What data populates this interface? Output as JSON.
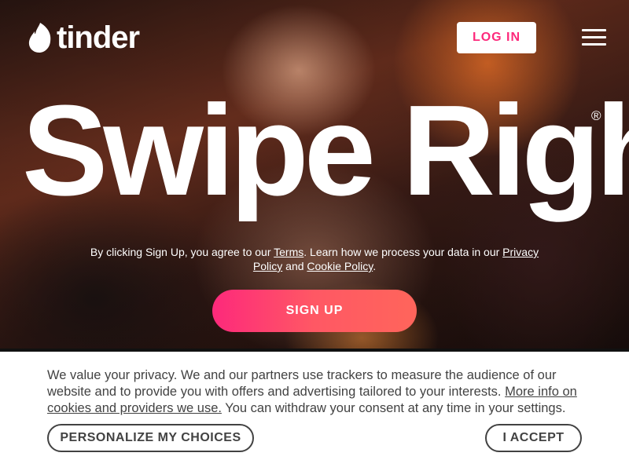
{
  "header": {
    "brand": "tinder",
    "login_label": "LOG IN"
  },
  "hero": {
    "headline": "Swipe Right",
    "registered_mark": "®",
    "disclaimer": {
      "prefix": "By clicking Sign Up, you agree to our ",
      "terms_link": "Terms",
      "middle": ". Learn how we process your data in our ",
      "privacy_link": "Privacy Policy",
      "and": " and ",
      "cookie_link": "Cookie Policy",
      "suffix": "."
    },
    "signup_label": "SIGN UP"
  },
  "cookie_banner": {
    "text_before": "We value your privacy. We and our partners use trackers to measure the audience of our website and to provide you with offers and advertising tailored to your interests. ",
    "more_info_link": "More info on cookies and providers we use.",
    "text_after": " You can withdraw your consent at any time in your settings.",
    "personalize_label": "PERSONALIZE MY CHOICES",
    "accept_label": "I ACCEPT"
  },
  "colors": {
    "brand_pink": "#fd297b",
    "brand_orange": "#ff655b",
    "text_dark": "#424242"
  },
  "icons": [
    "flame-icon",
    "hamburger-menu-icon"
  ]
}
